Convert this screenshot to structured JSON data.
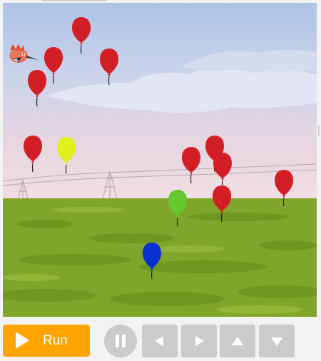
{
  "controls": {
    "run_label": "Run"
  },
  "icons": {
    "run": "play-icon",
    "pause": "pause-icon",
    "left": "arrow-left-icon",
    "right": "arrow-right-icon",
    "up": "arrow-up-icon",
    "down": "arrow-down-icon"
  },
  "colors": {
    "run_button": "#ffa400",
    "control_button": "#cbcbcb",
    "balloon_red": "#d21f26",
    "balloon_yellow": "#e2ef1f",
    "balloon_green": "#62c82b",
    "balloon_blue": "#0a2fd0",
    "grass": "#7fa62a"
  },
  "balloons": [
    {
      "color": "red"
    },
    {
      "color": "red"
    },
    {
      "color": "red"
    },
    {
      "color": "red"
    },
    {
      "color": "red"
    },
    {
      "color": "yellow"
    },
    {
      "color": "red"
    },
    {
      "color": "red"
    },
    {
      "color": "red"
    },
    {
      "color": "red"
    },
    {
      "color": "red"
    },
    {
      "color": "green"
    },
    {
      "color": "blue"
    }
  ]
}
